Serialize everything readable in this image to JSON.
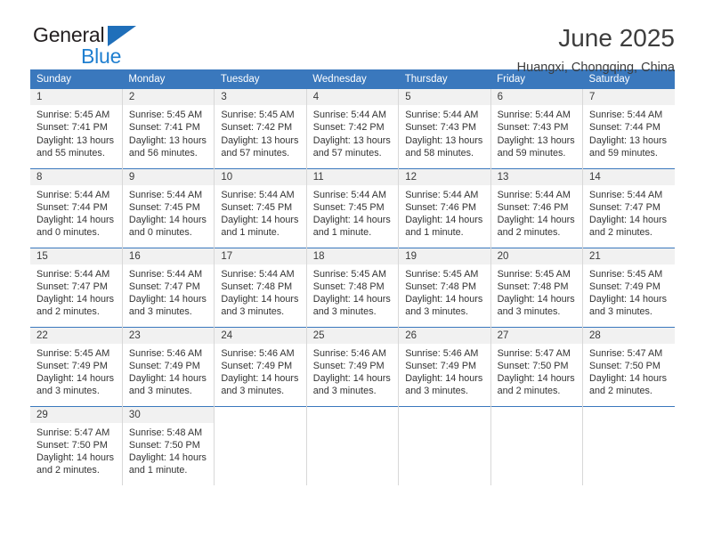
{
  "brand": {
    "word1": "General",
    "word2": "Blue",
    "triangle_color": "#1f6fba",
    "blue_color": "#1f7fd0"
  },
  "header": {
    "title": "June 2025",
    "location": "Huangxi, Chongqing, China"
  },
  "theme": {
    "header_blue": "#3a78bd",
    "daynum_bg": "#f1f1f1",
    "cell_border": "#d8d8d8"
  },
  "weekdays": [
    "Sunday",
    "Monday",
    "Tuesday",
    "Wednesday",
    "Thursday",
    "Friday",
    "Saturday"
  ],
  "weeks": [
    [
      {
        "day": "1",
        "sunrise": "Sunrise: 5:45 AM",
        "sunset": "Sunset: 7:41 PM",
        "daylight1": "Daylight: 13 hours",
        "daylight2": "and 55 minutes."
      },
      {
        "day": "2",
        "sunrise": "Sunrise: 5:45 AM",
        "sunset": "Sunset: 7:41 PM",
        "daylight1": "Daylight: 13 hours",
        "daylight2": "and 56 minutes."
      },
      {
        "day": "3",
        "sunrise": "Sunrise: 5:45 AM",
        "sunset": "Sunset: 7:42 PM",
        "daylight1": "Daylight: 13 hours",
        "daylight2": "and 57 minutes."
      },
      {
        "day": "4",
        "sunrise": "Sunrise: 5:44 AM",
        "sunset": "Sunset: 7:42 PM",
        "daylight1": "Daylight: 13 hours",
        "daylight2": "and 57 minutes."
      },
      {
        "day": "5",
        "sunrise": "Sunrise: 5:44 AM",
        "sunset": "Sunset: 7:43 PM",
        "daylight1": "Daylight: 13 hours",
        "daylight2": "and 58 minutes."
      },
      {
        "day": "6",
        "sunrise": "Sunrise: 5:44 AM",
        "sunset": "Sunset: 7:43 PM",
        "daylight1": "Daylight: 13 hours",
        "daylight2": "and 59 minutes."
      },
      {
        "day": "7",
        "sunrise": "Sunrise: 5:44 AM",
        "sunset": "Sunset: 7:44 PM",
        "daylight1": "Daylight: 13 hours",
        "daylight2": "and 59 minutes."
      }
    ],
    [
      {
        "day": "8",
        "sunrise": "Sunrise: 5:44 AM",
        "sunset": "Sunset: 7:44 PM",
        "daylight1": "Daylight: 14 hours",
        "daylight2": "and 0 minutes."
      },
      {
        "day": "9",
        "sunrise": "Sunrise: 5:44 AM",
        "sunset": "Sunset: 7:45 PM",
        "daylight1": "Daylight: 14 hours",
        "daylight2": "and 0 minutes."
      },
      {
        "day": "10",
        "sunrise": "Sunrise: 5:44 AM",
        "sunset": "Sunset: 7:45 PM",
        "daylight1": "Daylight: 14 hours",
        "daylight2": "and 1 minute."
      },
      {
        "day": "11",
        "sunrise": "Sunrise: 5:44 AM",
        "sunset": "Sunset: 7:45 PM",
        "daylight1": "Daylight: 14 hours",
        "daylight2": "and 1 minute."
      },
      {
        "day": "12",
        "sunrise": "Sunrise: 5:44 AM",
        "sunset": "Sunset: 7:46 PM",
        "daylight1": "Daylight: 14 hours",
        "daylight2": "and 1 minute."
      },
      {
        "day": "13",
        "sunrise": "Sunrise: 5:44 AM",
        "sunset": "Sunset: 7:46 PM",
        "daylight1": "Daylight: 14 hours",
        "daylight2": "and 2 minutes."
      },
      {
        "day": "14",
        "sunrise": "Sunrise: 5:44 AM",
        "sunset": "Sunset: 7:47 PM",
        "daylight1": "Daylight: 14 hours",
        "daylight2": "and 2 minutes."
      }
    ],
    [
      {
        "day": "15",
        "sunrise": "Sunrise: 5:44 AM",
        "sunset": "Sunset: 7:47 PM",
        "daylight1": "Daylight: 14 hours",
        "daylight2": "and 2 minutes."
      },
      {
        "day": "16",
        "sunrise": "Sunrise: 5:44 AM",
        "sunset": "Sunset: 7:47 PM",
        "daylight1": "Daylight: 14 hours",
        "daylight2": "and 3 minutes."
      },
      {
        "day": "17",
        "sunrise": "Sunrise: 5:44 AM",
        "sunset": "Sunset: 7:48 PM",
        "daylight1": "Daylight: 14 hours",
        "daylight2": "and 3 minutes."
      },
      {
        "day": "18",
        "sunrise": "Sunrise: 5:45 AM",
        "sunset": "Sunset: 7:48 PM",
        "daylight1": "Daylight: 14 hours",
        "daylight2": "and 3 minutes."
      },
      {
        "day": "19",
        "sunrise": "Sunrise: 5:45 AM",
        "sunset": "Sunset: 7:48 PM",
        "daylight1": "Daylight: 14 hours",
        "daylight2": "and 3 minutes."
      },
      {
        "day": "20",
        "sunrise": "Sunrise: 5:45 AM",
        "sunset": "Sunset: 7:48 PM",
        "daylight1": "Daylight: 14 hours",
        "daylight2": "and 3 minutes."
      },
      {
        "day": "21",
        "sunrise": "Sunrise: 5:45 AM",
        "sunset": "Sunset: 7:49 PM",
        "daylight1": "Daylight: 14 hours",
        "daylight2": "and 3 minutes."
      }
    ],
    [
      {
        "day": "22",
        "sunrise": "Sunrise: 5:45 AM",
        "sunset": "Sunset: 7:49 PM",
        "daylight1": "Daylight: 14 hours",
        "daylight2": "and 3 minutes."
      },
      {
        "day": "23",
        "sunrise": "Sunrise: 5:46 AM",
        "sunset": "Sunset: 7:49 PM",
        "daylight1": "Daylight: 14 hours",
        "daylight2": "and 3 minutes."
      },
      {
        "day": "24",
        "sunrise": "Sunrise: 5:46 AM",
        "sunset": "Sunset: 7:49 PM",
        "daylight1": "Daylight: 14 hours",
        "daylight2": "and 3 minutes."
      },
      {
        "day": "25",
        "sunrise": "Sunrise: 5:46 AM",
        "sunset": "Sunset: 7:49 PM",
        "daylight1": "Daylight: 14 hours",
        "daylight2": "and 3 minutes."
      },
      {
        "day": "26",
        "sunrise": "Sunrise: 5:46 AM",
        "sunset": "Sunset: 7:49 PM",
        "daylight1": "Daylight: 14 hours",
        "daylight2": "and 3 minutes."
      },
      {
        "day": "27",
        "sunrise": "Sunrise: 5:47 AM",
        "sunset": "Sunset: 7:50 PM",
        "daylight1": "Daylight: 14 hours",
        "daylight2": "and 2 minutes."
      },
      {
        "day": "28",
        "sunrise": "Sunrise: 5:47 AM",
        "sunset": "Sunset: 7:50 PM",
        "daylight1": "Daylight: 14 hours",
        "daylight2": "and 2 minutes."
      }
    ],
    [
      {
        "day": "29",
        "sunrise": "Sunrise: 5:47 AM",
        "sunset": "Sunset: 7:50 PM",
        "daylight1": "Daylight: 14 hours",
        "daylight2": "and 2 minutes."
      },
      {
        "day": "30",
        "sunrise": "Sunrise: 5:48 AM",
        "sunset": "Sunset: 7:50 PM",
        "daylight1": "Daylight: 14 hours",
        "daylight2": "and 1 minute."
      },
      {
        "day": "",
        "sunrise": "",
        "sunset": "",
        "daylight1": "",
        "daylight2": ""
      },
      {
        "day": "",
        "sunrise": "",
        "sunset": "",
        "daylight1": "",
        "daylight2": ""
      },
      {
        "day": "",
        "sunrise": "",
        "sunset": "",
        "daylight1": "",
        "daylight2": ""
      },
      {
        "day": "",
        "sunrise": "",
        "sunset": "",
        "daylight1": "",
        "daylight2": ""
      },
      {
        "day": "",
        "sunrise": "",
        "sunset": "",
        "daylight1": "",
        "daylight2": ""
      }
    ]
  ]
}
